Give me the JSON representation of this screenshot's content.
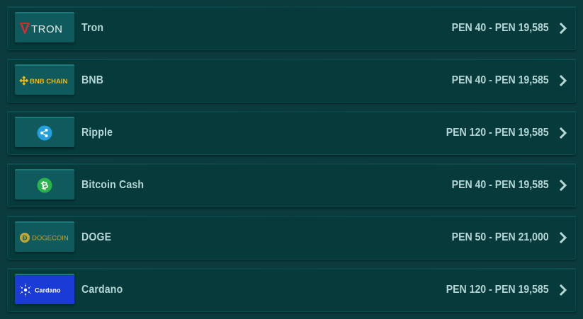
{
  "colors": {
    "background": "#0c3b3e",
    "row": "#063a3b",
    "logo_tile": "#0f5a5c",
    "text": "#b6d7d6",
    "tron_red": "#e0282d",
    "bnb_yellow": "#f0b90b",
    "xrp_blue": "#23a0dd",
    "bch_green": "#2ab34a",
    "doge_gold": "#c2a633",
    "cardano_blue": "#1b3bd6"
  },
  "currencies": [
    {
      "name": "Tron",
      "range": "PEN 40 - PEN 19,585",
      "logo_text": "TRON",
      "icon": "tron-logo-icon"
    },
    {
      "name": "BNB",
      "range": "PEN 40 - PEN 19,585",
      "logo_text": "BNB CHAIN",
      "icon": "bnb-chain-logo-icon"
    },
    {
      "name": "Ripple",
      "range": "PEN 120 - PEN 19,585",
      "logo_text": "",
      "icon": "ripple-logo-icon"
    },
    {
      "name": "Bitcoin Cash",
      "range": "PEN 40 - PEN 19,585",
      "logo_text": "",
      "icon": "bitcoin-cash-logo-icon"
    },
    {
      "name": "DOGE",
      "range": "PEN 50 - PEN 21,000",
      "logo_text": "DOGECOIN",
      "icon": "dogecoin-logo-icon"
    },
    {
      "name": "Cardano",
      "range": "PEN 120 - PEN 19,585",
      "logo_text": "Cardano",
      "icon": "cardano-logo-icon"
    }
  ],
  "chevron_icon": "chevron-right-icon"
}
